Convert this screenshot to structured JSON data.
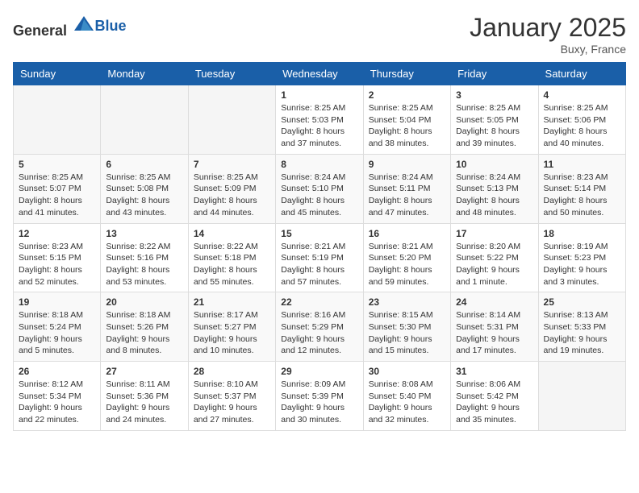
{
  "header": {
    "logo_general": "General",
    "logo_blue": "Blue",
    "month": "January 2025",
    "location": "Buxy, France"
  },
  "weekdays": [
    "Sunday",
    "Monday",
    "Tuesday",
    "Wednesday",
    "Thursday",
    "Friday",
    "Saturday"
  ],
  "weeks": [
    [
      {
        "day": "",
        "info": ""
      },
      {
        "day": "",
        "info": ""
      },
      {
        "day": "",
        "info": ""
      },
      {
        "day": "1",
        "info": "Sunrise: 8:25 AM\nSunset: 5:03 PM\nDaylight: 8 hours\nand 37 minutes."
      },
      {
        "day": "2",
        "info": "Sunrise: 8:25 AM\nSunset: 5:04 PM\nDaylight: 8 hours\nand 38 minutes."
      },
      {
        "day": "3",
        "info": "Sunrise: 8:25 AM\nSunset: 5:05 PM\nDaylight: 8 hours\nand 39 minutes."
      },
      {
        "day": "4",
        "info": "Sunrise: 8:25 AM\nSunset: 5:06 PM\nDaylight: 8 hours\nand 40 minutes."
      }
    ],
    [
      {
        "day": "5",
        "info": "Sunrise: 8:25 AM\nSunset: 5:07 PM\nDaylight: 8 hours\nand 41 minutes."
      },
      {
        "day": "6",
        "info": "Sunrise: 8:25 AM\nSunset: 5:08 PM\nDaylight: 8 hours\nand 43 minutes."
      },
      {
        "day": "7",
        "info": "Sunrise: 8:25 AM\nSunset: 5:09 PM\nDaylight: 8 hours\nand 44 minutes."
      },
      {
        "day": "8",
        "info": "Sunrise: 8:24 AM\nSunset: 5:10 PM\nDaylight: 8 hours\nand 45 minutes."
      },
      {
        "day": "9",
        "info": "Sunrise: 8:24 AM\nSunset: 5:11 PM\nDaylight: 8 hours\nand 47 minutes."
      },
      {
        "day": "10",
        "info": "Sunrise: 8:24 AM\nSunset: 5:13 PM\nDaylight: 8 hours\nand 48 minutes."
      },
      {
        "day": "11",
        "info": "Sunrise: 8:23 AM\nSunset: 5:14 PM\nDaylight: 8 hours\nand 50 minutes."
      }
    ],
    [
      {
        "day": "12",
        "info": "Sunrise: 8:23 AM\nSunset: 5:15 PM\nDaylight: 8 hours\nand 52 minutes."
      },
      {
        "day": "13",
        "info": "Sunrise: 8:22 AM\nSunset: 5:16 PM\nDaylight: 8 hours\nand 53 minutes."
      },
      {
        "day": "14",
        "info": "Sunrise: 8:22 AM\nSunset: 5:18 PM\nDaylight: 8 hours\nand 55 minutes."
      },
      {
        "day": "15",
        "info": "Sunrise: 8:21 AM\nSunset: 5:19 PM\nDaylight: 8 hours\nand 57 minutes."
      },
      {
        "day": "16",
        "info": "Sunrise: 8:21 AM\nSunset: 5:20 PM\nDaylight: 8 hours\nand 59 minutes."
      },
      {
        "day": "17",
        "info": "Sunrise: 8:20 AM\nSunset: 5:22 PM\nDaylight: 9 hours\nand 1 minute."
      },
      {
        "day": "18",
        "info": "Sunrise: 8:19 AM\nSunset: 5:23 PM\nDaylight: 9 hours\nand 3 minutes."
      }
    ],
    [
      {
        "day": "19",
        "info": "Sunrise: 8:18 AM\nSunset: 5:24 PM\nDaylight: 9 hours\nand 5 minutes."
      },
      {
        "day": "20",
        "info": "Sunrise: 8:18 AM\nSunset: 5:26 PM\nDaylight: 9 hours\nand 8 minutes."
      },
      {
        "day": "21",
        "info": "Sunrise: 8:17 AM\nSunset: 5:27 PM\nDaylight: 9 hours\nand 10 minutes."
      },
      {
        "day": "22",
        "info": "Sunrise: 8:16 AM\nSunset: 5:29 PM\nDaylight: 9 hours\nand 12 minutes."
      },
      {
        "day": "23",
        "info": "Sunrise: 8:15 AM\nSunset: 5:30 PM\nDaylight: 9 hours\nand 15 minutes."
      },
      {
        "day": "24",
        "info": "Sunrise: 8:14 AM\nSunset: 5:31 PM\nDaylight: 9 hours\nand 17 minutes."
      },
      {
        "day": "25",
        "info": "Sunrise: 8:13 AM\nSunset: 5:33 PM\nDaylight: 9 hours\nand 19 minutes."
      }
    ],
    [
      {
        "day": "26",
        "info": "Sunrise: 8:12 AM\nSunset: 5:34 PM\nDaylight: 9 hours\nand 22 minutes."
      },
      {
        "day": "27",
        "info": "Sunrise: 8:11 AM\nSunset: 5:36 PM\nDaylight: 9 hours\nand 24 minutes."
      },
      {
        "day": "28",
        "info": "Sunrise: 8:10 AM\nSunset: 5:37 PM\nDaylight: 9 hours\nand 27 minutes."
      },
      {
        "day": "29",
        "info": "Sunrise: 8:09 AM\nSunset: 5:39 PM\nDaylight: 9 hours\nand 30 minutes."
      },
      {
        "day": "30",
        "info": "Sunrise: 8:08 AM\nSunset: 5:40 PM\nDaylight: 9 hours\nand 32 minutes."
      },
      {
        "day": "31",
        "info": "Sunrise: 8:06 AM\nSunset: 5:42 PM\nDaylight: 9 hours\nand 35 minutes."
      },
      {
        "day": "",
        "info": ""
      }
    ]
  ]
}
